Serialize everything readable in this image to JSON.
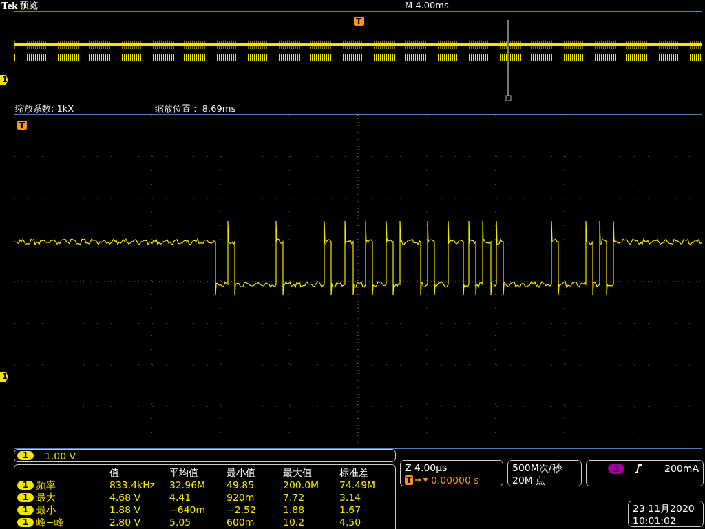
{
  "header": {
    "brand": "Tek",
    "mode": "预览",
    "timebase": "M 4.00ms"
  },
  "overview": {
    "trigger_marker": "T",
    "channel_marker": "1"
  },
  "zoom_info": {
    "factor": "缩放系数: 1kX",
    "position": "缩放位置 :  8.69ms"
  },
  "main": {
    "trigger_marker": "T",
    "channel_marker": "1"
  },
  "channel_scale": {
    "channel": "1",
    "scale": "1.00 V"
  },
  "measurements": {
    "columns": [
      "值",
      "平均值",
      "最小值",
      "最大值",
      "标准差"
    ],
    "rows": [
      {
        "channel": "1",
        "name": "频率",
        "values": [
          "833.4kHz",
          "32.96M",
          "49.85",
          "200.0M",
          "74.49M"
        ]
      },
      {
        "channel": "1",
        "name": "最大",
        "values": [
          "4.68 V",
          "4.41",
          "920m",
          "7.72",
          "3.14"
        ]
      },
      {
        "channel": "1",
        "name": "最小",
        "values": [
          "1.88 V",
          "−640m",
          "−2.52",
          "1.88",
          "1.67"
        ]
      },
      {
        "channel": "1",
        "name": "峰−峰",
        "values": [
          "2.80 V",
          "5.05",
          "600m",
          "10.2",
          "4.50"
        ]
      }
    ]
  },
  "zoom_box": {
    "scale": "Z 4.00µs",
    "trigger_badge": "T",
    "trigger_offset": "0.00000 s"
  },
  "acquisition": {
    "sample_rate": "500M次/秒",
    "record_length": "20M 点"
  },
  "trigger": {
    "source": "3",
    "level": "200mA"
  },
  "datetime": {
    "date": "23 11月2020",
    "time": "10:01:02"
  }
}
